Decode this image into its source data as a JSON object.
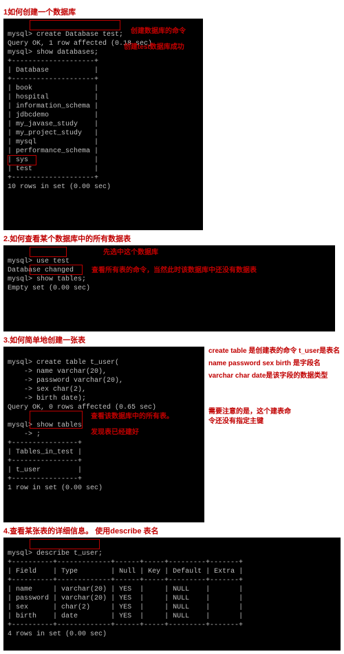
{
  "s1": {
    "title": "1如何创建一个数据库",
    "line1": "mysql> create Database test;",
    "line2": "Query OK, 1 row affected (0.18 sec)",
    "line3": "mysql> show databases;",
    "sep": "+--------------------+",
    "hdr": "| Database           |",
    "r1": "| book               |",
    "r2": "| hospital           |",
    "r3": "| information_schema |",
    "r4": "| jdbcdemo           |",
    "r5": "| my_javase_study    |",
    "r6": "| my_project_study   |",
    "r7": "| mysql              |",
    "r8": "| performance_schema |",
    "r9": "| sys                |",
    "r10": "| test               |",
    "foot": "10 rows in set (0.00 sec)",
    "a1": "创建数据库的命令",
    "a2": "创建test数据库成功"
  },
  "s2": {
    "title": "2.如何查看某个数据库中的所有数据表",
    "l1": "mysql> use test",
    "l2": "Database changed",
    "l3": "mysql> show tables;",
    "l4": "Empty set (0.00 sec)",
    "a1": "先选中这个数据库",
    "a2": "查看所有表的命令，当然此时该数据库中还没有数据表"
  },
  "s3": {
    "title": "3.如何简单地创建一张表",
    "l1": "mysql> create table t_user(",
    "l2": "    -> name varchar(20),",
    "l3": "    -> password varchar(20),",
    "l4": "    -> sex char(2),",
    "l5": "    -> birth date);",
    "l6": "Query OK, 0 rows affected (0.65 sec)",
    "blank": "",
    "l7": "mysql> show tables",
    "l8": "    -> ;",
    "sep": "+----------------+",
    "hdr": "| Tables_in_test |",
    "r1": "| t_user         |",
    "foot": "1 row in set (0.00 sec)",
    "a1": "create table 是创建表的命令 t_user是表名",
    "a2": "name password sex birth  是字段名",
    "a3": "varchar char date是该字段的数据类型",
    "a4": "查看该数据库中的所有表。",
    "a5": "发现表已经建好",
    "a6": "需要注意的是，这个建表命令还没有指定主键"
  },
  "s4": {
    "title": "4.查看某张表的详细信息。  使用describe 表名",
    "l1": "mysql> describe t_user;",
    "h_field": "Field",
    "h_type": "Type",
    "h_null": "Null",
    "h_key": "Key",
    "h_def": "Default",
    "h_ext": "Extra",
    "c1f": "name",
    "c1t": "varchar(20)",
    "c1n": "YES",
    "c1d": "NULL",
    "c2f": "password",
    "c2t": "varchar(20)",
    "c2n": "YES",
    "c2d": "NULL",
    "c3f": "sex",
    "c3t": "char(2)",
    "c3n": "YES",
    "c3d": "NULL",
    "c4f": "birth",
    "c4t": "date",
    "c4n": "YES",
    "c4d": "NULL",
    "foot": "4 rows in set (0.00 sec)"
  }
}
